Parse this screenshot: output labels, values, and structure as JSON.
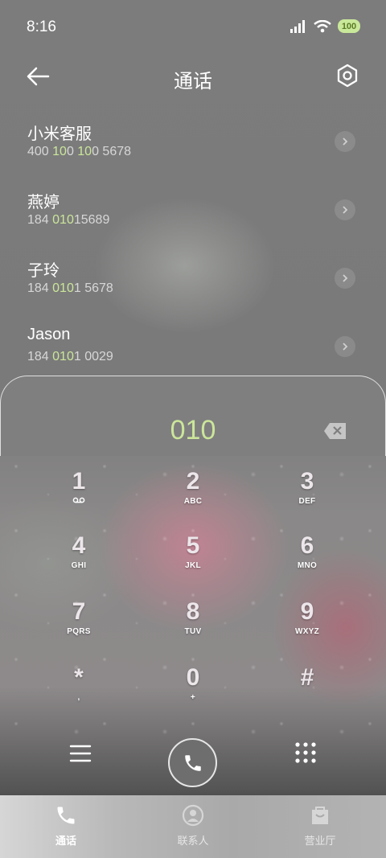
{
  "status": {
    "time": "8:16",
    "battery": "100"
  },
  "header": {
    "title": "通话"
  },
  "contacts": [
    {
      "name": "小米客服",
      "num_parts": [
        "400 ",
        "10",
        "0 ",
        "10",
        "0 5678"
      ]
    },
    {
      "name": "燕婷",
      "num_parts": [
        "184 ",
        "010",
        "15689"
      ]
    },
    {
      "name": "子玲",
      "num_parts": [
        "184 ",
        "010",
        "1 5678"
      ]
    },
    {
      "name": "Jason",
      "num_parts": [
        "184 ",
        "010",
        "1 0029"
      ]
    }
  ],
  "dialer": {
    "number": "010",
    "keys": [
      {
        "digit": "1",
        "letters": "ᴼᴼ"
      },
      {
        "digit": "2",
        "letters": "ABC"
      },
      {
        "digit": "3",
        "letters": "DEF"
      },
      {
        "digit": "4",
        "letters": "GHI"
      },
      {
        "digit": "5",
        "letters": "JKL"
      },
      {
        "digit": "6",
        "letters": "MNO"
      },
      {
        "digit": "7",
        "letters": "PQRS"
      },
      {
        "digit": "8",
        "letters": "TUV"
      },
      {
        "digit": "9",
        "letters": "WXYZ"
      },
      {
        "digit": "*",
        "letters": ","
      },
      {
        "digit": "0",
        "letters": "+"
      },
      {
        "digit": "#",
        "letters": ""
      }
    ]
  },
  "tabs": [
    {
      "label": "通话",
      "icon": "phone-icon",
      "active": true
    },
    {
      "label": "联系人",
      "icon": "contacts-icon",
      "active": false
    },
    {
      "label": "营业厅",
      "icon": "service-hall-icon",
      "active": false
    }
  ],
  "colors": {
    "highlight": "#cbe69a",
    "battery": "#c9e89a"
  }
}
